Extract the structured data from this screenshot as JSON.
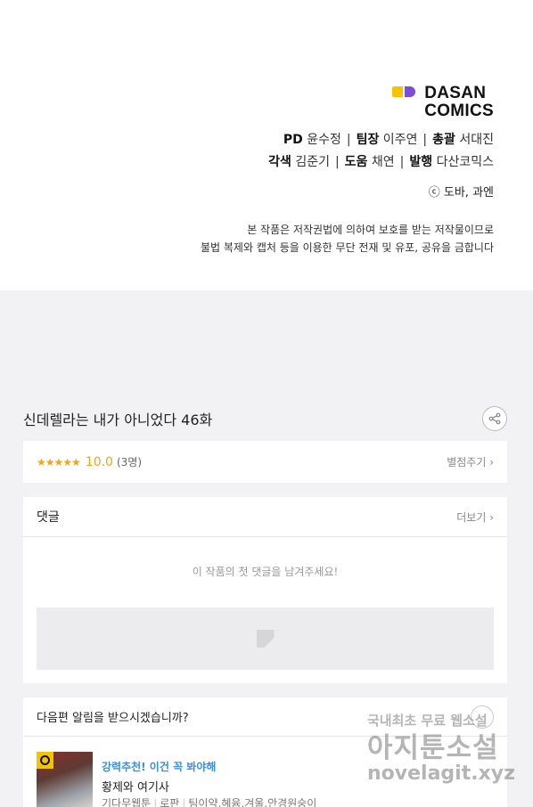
{
  "logo": {
    "line1": "DASAN",
    "line2": "COMICS"
  },
  "credits": {
    "line1": [
      {
        "role": "PD",
        "name": "윤수정"
      },
      {
        "role": "팀장",
        "name": "이주연"
      },
      {
        "role": "총괄",
        "name": "서대진"
      }
    ],
    "line2": [
      {
        "role": "각색",
        "name": "김준기"
      },
      {
        "role": "도움",
        "name": "채연"
      },
      {
        "role": "발행",
        "name": "다산코믹스"
      }
    ],
    "separator": "|",
    "copyright": "ⓒ 도바, 과엔",
    "notice_line1": "본 작품은 저작권법에 의하여 보호를 받는 저작물이므로",
    "notice_line2": "불법 복제와 캡처 등을 이용한 무단 전재 및 유포, 공유을 금합니다"
  },
  "episode": {
    "title": "신데렐라는 내가 아니었다 46화"
  },
  "rating": {
    "stars": "★★★★★",
    "score": "10.0",
    "count": "(3명)",
    "rate_label": "별점주기 ›"
  },
  "comments": {
    "title": "댓글",
    "more_label": "더보기 ›",
    "empty_message": "이 작품의 첫 댓글을 남겨주세요!"
  },
  "next_alert": {
    "title": "다음편 알림을 받으시겠습니까?"
  },
  "recommendation": {
    "tag": "강력추천! 이건 꼭 봐야해",
    "name": "황제와 여기사",
    "meta": [
      "기다무웹툰",
      "로판",
      "팀이약,혜윰,겨울,안경원숭이"
    ]
  },
  "watermark": {
    "line1": "국내최초 무료 웹소설",
    "line2": "아지툰소설",
    "line3": "novelagit.xyz"
  },
  "colors": {
    "accent_orange": "#f2a51a",
    "link_blue": "#3a8ee6",
    "logo_yellow": "#f4c400",
    "logo_purple": "#7b4fd4"
  }
}
